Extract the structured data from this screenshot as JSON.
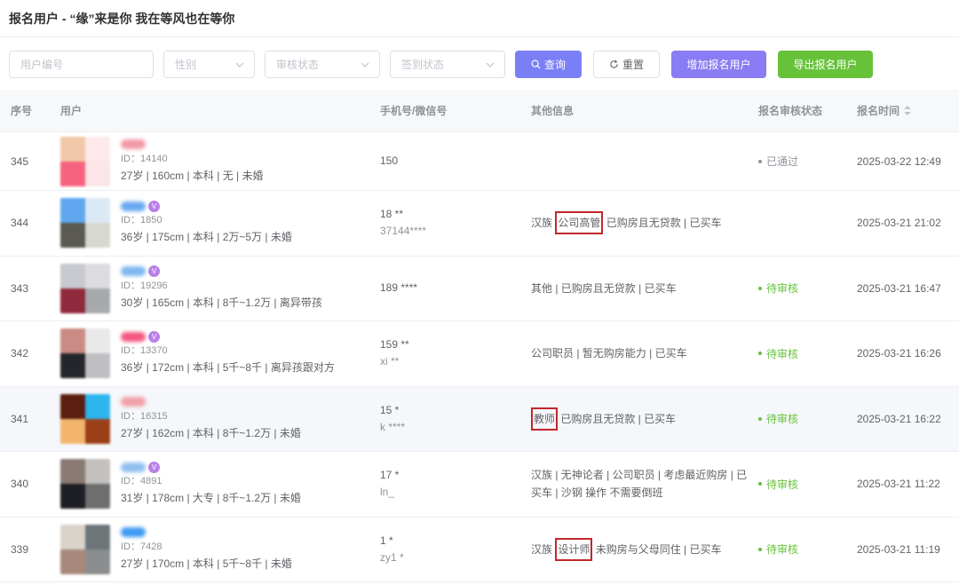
{
  "page": {
    "title": "报名用户 - “缘”来是你 我在等风也在等你"
  },
  "filters": {
    "user_id_placeholder": "用户编号",
    "gender_placeholder": "性别",
    "review_placeholder": "审核状态",
    "checkin_placeholder": "签到状态",
    "query_label": "查询",
    "reset_label": "重置",
    "add_label": "增加报名用户",
    "export_label": "导出报名用户"
  },
  "table": {
    "headers": {
      "no": "序号",
      "user": "用户",
      "phone": "手机号/微信号",
      "other": "其他信息",
      "status": "报名审核状态",
      "time": "报名时间"
    },
    "rows": [
      {
        "no": "345",
        "uid": "ID：14140",
        "tags": "27岁 | 160cm | 本科 | 无 | 未婚",
        "phone1": "150",
        "phone2": "",
        "other_pre": "",
        "other_hl": "",
        "other_post": "",
        "status": "已通过",
        "status_type": "pass",
        "time": "2025-03-22 12:49",
        "avatar": [
          "#f2c9a8",
          "#fde9ea",
          "#f7627e",
          "#fbe5e6"
        ],
        "name_color": "#f29aa7",
        "vip": false
      },
      {
        "no": "344",
        "uid": "ID：1850",
        "tags": "36岁 | 175cm | 本科 | 2万~5万 | 未婚",
        "phone1": "18          **",
        "phone2": "37144****",
        "other_pre": "汉族 ",
        "other_hl": "公司高管",
        "other_post": " 已购房且无贷款 | 已买车",
        "status": "",
        "status_type": "partial",
        "time": "2025-03-21 21:02",
        "avatar": [
          "#5fa7ef",
          "#dbe9f6",
          "#5a5a52",
          "#d7d8d0"
        ],
        "name_color": "#6aa9f0",
        "vip": true
      },
      {
        "no": "343",
        "uid": "ID：19296",
        "tags": "30岁 | 165cm | 本科 | 8千~1.2万 | 离异带孩",
        "phone1": "189     ****",
        "phone2": "",
        "other_pre": "其他 | 已购房且无贷款 | 已买车",
        "other_hl": "",
        "other_post": "",
        "status": "待审核",
        "status_type": "pending",
        "time": "2025-03-21 16:47",
        "avatar": [
          "#c8c8d0",
          "#dcdce0",
          "#8e2a3b",
          "#a7a9ad"
        ],
        "name_color": "#7fb8ef",
        "vip": true
      },
      {
        "no": "342",
        "uid": "ID：13370",
        "tags": "36岁 | 172cm | 本科 | 5千~8千 | 离异孩跟对方",
        "phone1": "159     **",
        "phone2": "xi        **",
        "other_pre": "公司职员 | 暂无购房能力 | 已买车",
        "other_hl": "",
        "other_post": "",
        "status": "待审核",
        "status_type": "pending",
        "time": "2025-03-21 16:26",
        "avatar": [
          "#c98b84",
          "#e9e9ea",
          "#25262b",
          "#bfbfc2"
        ],
        "name_color": "#f4577f",
        "vip": true
      },
      {
        "no": "341",
        "uid": "ID：16315",
        "tags": "27岁 | 162cm | 本科 | 8千~1.2万 | 未婚",
        "phone1": "15        *",
        "phone2": "k ****",
        "other_pre": "",
        "other_hl": "教师",
        "other_post": " 已购房且无贷款 | 已买车",
        "status": "待审核",
        "status_type": "pending",
        "time": "2025-03-21 16:22",
        "avatar": [
          "#5a1f10",
          "#2eb5ee",
          "#f3b56e",
          "#9b3f16"
        ],
        "name_color": "#f0a0a8",
        "vip": false
      },
      {
        "no": "340",
        "uid": "ID：4891",
        "tags": "31岁 | 178cm | 大专 | 8千~1.2万 | 未婚",
        "phone1": "17          *",
        "phone2": "ln_",
        "other_pre": "汉族 | 无神论者 | 公司职员 | 考虑最近购房 | 已买车 | 沙钢 操作 不需要倒班",
        "other_hl": "",
        "other_post": "",
        "status": "待审核",
        "status_type": "pending",
        "time": "2025-03-21 11:22",
        "avatar": [
          "#8b7a74",
          "#c3c0bd",
          "#1d1f24",
          "#6e6e6e"
        ],
        "name_color": "#8fbff0",
        "vip": true
      },
      {
        "no": "339",
        "uid": "ID：7428",
        "tags": "27岁 | 170cm | 本科 | 5千~8千 | 未婚",
        "phone1": "1         *",
        "phone2": "zy1        *",
        "other_pre": "汉族 ",
        "other_hl": "设计师",
        "other_post": " 未购房与父母同住 | 已买车",
        "status": "待审核",
        "status_type": "pending",
        "time": "2025-03-21 11:19",
        "avatar": [
          "#d9d3cc",
          "#6d7579",
          "#a8887a",
          "#8b8d8f"
        ],
        "name_color": "#3f9af2",
        "vip": false
      }
    ]
  }
}
